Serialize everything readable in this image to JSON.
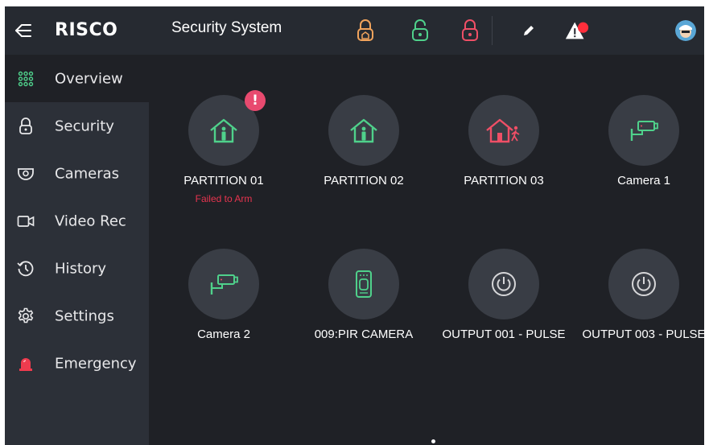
{
  "app": {
    "brand": "RISCO",
    "title": "Security System"
  },
  "sidebar": {
    "items": [
      {
        "label": "Overview",
        "icon": "grid-dots-icon",
        "active": true
      },
      {
        "label": "Security",
        "icon": "padlock-icon"
      },
      {
        "label": "Cameras",
        "icon": "dome-camera-icon"
      },
      {
        "label": "Video Rec",
        "icon": "video-camera-icon"
      },
      {
        "label": "History",
        "icon": "clock-history-icon"
      },
      {
        "label": "Settings",
        "icon": "gear-icon"
      },
      {
        "label": "Emergency",
        "icon": "siren-icon"
      }
    ]
  },
  "topbar": {
    "actions": [
      "arm-stay-lock-icon",
      "disarm-unlock-icon",
      "arm-lock-icon",
      "edit-pencil-icon",
      "alert-triangle-icon"
    ],
    "colors": {
      "partial": "#f0a35c",
      "disarm": "#4fd18b",
      "arm": "#ef4f66",
      "alert_dot": "#ff2e3b"
    }
  },
  "tiles": [
    {
      "label": "PARTITION 01",
      "status": "Failed to Arm",
      "badge": "!",
      "icon": "house-person-icon"
    },
    {
      "label": "PARTITION 02",
      "status": "",
      "icon": "house-person-icon"
    },
    {
      "label": "PARTITION 03",
      "status": "",
      "icon": "house-person-leaving-icon"
    },
    {
      "label": "Camera 1",
      "status": "",
      "icon": "security-camera-icon"
    },
    {
      "label": "Camera 2",
      "status": "",
      "icon": "security-camera-icon"
    },
    {
      "label": "009:PIR CAMERA",
      "status": "",
      "icon": "pir-camera-icon"
    },
    {
      "label": "OUTPUT 001 - PULSE",
      "status": "",
      "icon": "power-icon"
    },
    {
      "label": "OUTPUT 003 - PULSE",
      "status": "",
      "icon": "power-icon"
    }
  ],
  "colors": {
    "accent": "#4fd18b",
    "danger": "#e8344f",
    "ring": "#d6d6d8"
  }
}
